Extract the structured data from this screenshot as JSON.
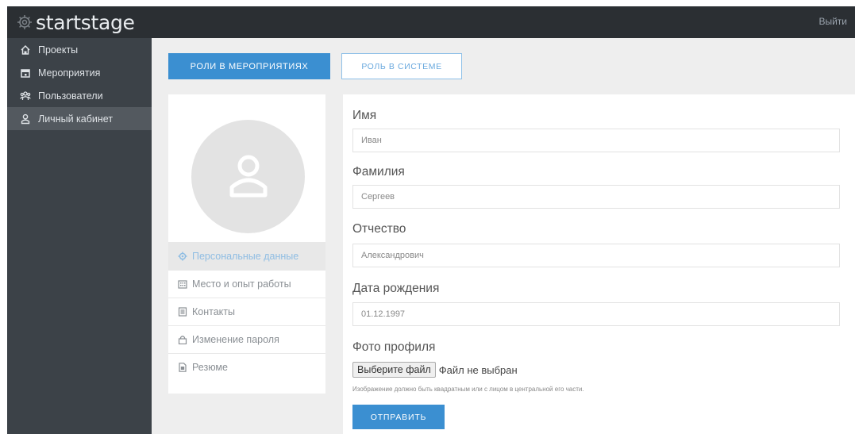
{
  "app": {
    "logo_text": "startstage",
    "logout_label": "Выйти"
  },
  "sidebar": {
    "items": [
      {
        "label": "Проекты",
        "icon": "projects-icon"
      },
      {
        "label": "Мероприятия",
        "icon": "calendar-icon"
      },
      {
        "label": "Пользователи",
        "icon": "users-icon"
      },
      {
        "label": "Личный кабинет",
        "icon": "user-icon",
        "active": true
      }
    ]
  },
  "tabs": {
    "roles_events": "РОЛИ В МЕРОПРИЯТИЯХ",
    "role_system": "РОЛЬ В СИСТЕМЕ"
  },
  "profile_menu": {
    "items": [
      {
        "label": "Персональные данные",
        "icon": "gear-icon",
        "active": true
      },
      {
        "label": "Место и опыт работы",
        "icon": "building-icon"
      },
      {
        "label": "Контакты",
        "icon": "contacts-icon"
      },
      {
        "label": "Изменение пароля",
        "icon": "lock-icon"
      },
      {
        "label": "Резюме",
        "icon": "document-icon"
      }
    ]
  },
  "form": {
    "first_name": {
      "label": "Имя",
      "value": "Иван"
    },
    "last_name": {
      "label": "Фамилия",
      "value": "Сергеев"
    },
    "patronymic": {
      "label": "Отчество",
      "value": "Александрович"
    },
    "birth_date": {
      "label": "Дата рождения",
      "value": "01.12.1997"
    },
    "photo": {
      "label": "Фото профиля",
      "choose_button": "Выберите файл",
      "no_file": "Файл не выбран",
      "hint": "Изображение должно быть квадратным или с лицом в центральной его части."
    },
    "submit_label": "ОТПРАВИТЬ"
  },
  "colors": {
    "topbar": "#2b2f33",
    "sidebar": "#3c4248",
    "sidebar_active": "#53595f",
    "accent": "#3b8fd1",
    "main_bg": "#eeeeee"
  }
}
